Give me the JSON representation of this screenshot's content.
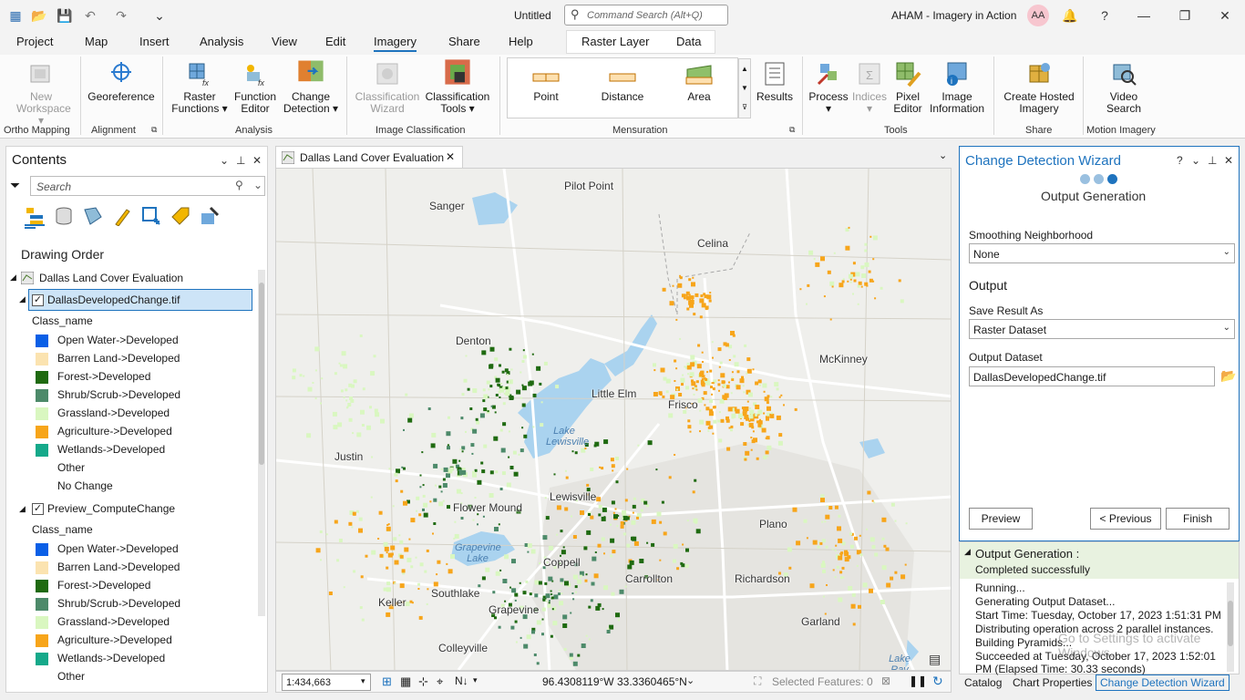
{
  "titlebar": {
    "doc_title": "Untitled",
    "search_placeholder": "Command Search (Alt+Q)",
    "project_title": "AHAM - Imagery in Action",
    "user_initials": "AA"
  },
  "ribbon_tabs": [
    "Project",
    "Map",
    "Insert",
    "Analysis",
    "View",
    "Edit",
    "Imagery",
    "Share",
    "Help"
  ],
  "active_tab": "Imagery",
  "context_tabs": [
    "Raster Layer",
    "Data"
  ],
  "ribbon": {
    "new_workspace": "New\nWorkspace",
    "georeference": "Georeference",
    "raster_functions": "Raster\nFunctions",
    "function_editor": "Function\nEditor",
    "change_detection": "Change\nDetection",
    "classification_wizard": "Classification\nWizard",
    "classification_tools": "Classification\nTools",
    "point": "Point",
    "distance": "Distance",
    "area": "Area",
    "results": "Results",
    "process": "Process",
    "indices": "Indices",
    "pixel_editor": "Pixel\nEditor",
    "image_information": "Image\nInformation",
    "create_hosted_imagery": "Create Hosted\nImagery",
    "video_search": "Video\nSearch",
    "groups": {
      "ortho_mapping": "Ortho Mapping",
      "alignment": "Alignment",
      "analysis": "Analysis",
      "image_classification": "Image Classification",
      "mensuration": "Mensuration",
      "tools": "Tools",
      "share": "Share",
      "motion_imagery": "Motion Imagery"
    }
  },
  "contents": {
    "title": "Contents",
    "search_placeholder": "Search",
    "drawing_order": "Drawing Order",
    "map_name": "Dallas Land Cover Evaluation",
    "layer1": "DallasDevelopedChange.tif",
    "layer2": "Preview_ComputeChange",
    "class_name_label": "Class_name",
    "classes1": [
      {
        "label": "Open Water->Developed",
        "color": "#0a5fe6"
      },
      {
        "label": "Barren Land->Developed",
        "color": "#fbe3b0"
      },
      {
        "label": "Forest->Developed",
        "color": "#1f6a10"
      },
      {
        "label": "Shrub/Scrub->Developed",
        "color": "#4d8a6a"
      },
      {
        "label": "Grassland->Developed",
        "color": "#d9f7c0"
      },
      {
        "label": "Agriculture->Developed",
        "color": "#f7a51a"
      },
      {
        "label": "Wetlands->Developed",
        "color": "#15a98a"
      },
      {
        "label": "Other",
        "color": ""
      },
      {
        "label": "No Change",
        "color": ""
      }
    ],
    "classes2": [
      {
        "label": "Open Water->Developed",
        "color": "#0a5fe6"
      },
      {
        "label": "Barren Land->Developed",
        "color": "#fbe3b0"
      },
      {
        "label": "Forest->Developed",
        "color": "#1f6a10"
      },
      {
        "label": "Shrub/Scrub->Developed",
        "color": "#4d8a6a"
      },
      {
        "label": "Grassland->Developed",
        "color": "#d9f7c0"
      },
      {
        "label": "Agriculture->Developed",
        "color": "#f7a51a"
      },
      {
        "label": "Wetlands->Developed",
        "color": "#15a98a"
      },
      {
        "label": "Other",
        "color": ""
      }
    ]
  },
  "map": {
    "tab_title": "Dallas Land Cover Evaluation",
    "cities": [
      {
        "name": "Pilot Point"
      },
      {
        "name": "Sanger"
      },
      {
        "name": "Celina"
      },
      {
        "name": "Denton"
      },
      {
        "name": "McKinney"
      },
      {
        "name": "Little Elm"
      },
      {
        "name": "Frisco"
      },
      {
        "name": "Justin"
      },
      {
        "name": "Flower Mound"
      },
      {
        "name": "Lewisville"
      },
      {
        "name": "Plano"
      },
      {
        "name": "Coppell"
      },
      {
        "name": "Carrollton"
      },
      {
        "name": "Richardson"
      },
      {
        "name": "Southlake"
      },
      {
        "name": "Keller"
      },
      {
        "name": "Grapevine"
      },
      {
        "name": "Garland"
      },
      {
        "name": "Colleyville"
      }
    ],
    "water_labels": [
      "Lake Lewisville",
      "Grapevine Lake",
      "Lake Ray"
    ],
    "scale": "1:434,663",
    "coordinates": "96.4308119°W 33.3360465°N",
    "selected_features": "Selected Features: 0"
  },
  "wizard": {
    "title": "Change Detection Wizard",
    "step_title": "Output Generation",
    "smoothing_label": "Smoothing Neighborhood",
    "smoothing_value": "None",
    "output_heading": "Output",
    "save_as_label": "Save Result As",
    "save_as_value": "Raster Dataset",
    "output_dataset_label": "Output Dataset",
    "output_dataset_value": "DallasDevelopedChange.tif",
    "preview": "Preview",
    "previous": "< Previous",
    "finish": "Finish"
  },
  "messages": {
    "heading": "Output Generation :",
    "status": "Completed successfully",
    "lines": [
      "Running...",
      "Generating Output Dataset...",
      "Start Time: Tuesday, October 17, 2023 1:51:31 PM",
      "Distributing operation across 2 parallel instances.",
      "Building Pyramids...",
      "Succeeded at Tuesday, October 17, 2023 1:52:01",
      "PM (Elapsed Time: 30.33 seconds)"
    ],
    "watermark": "Go to Settings to activate Windows."
  },
  "bottom_tabs": [
    "Catalog",
    "Chart Properties",
    "Change Detection Wizard"
  ]
}
